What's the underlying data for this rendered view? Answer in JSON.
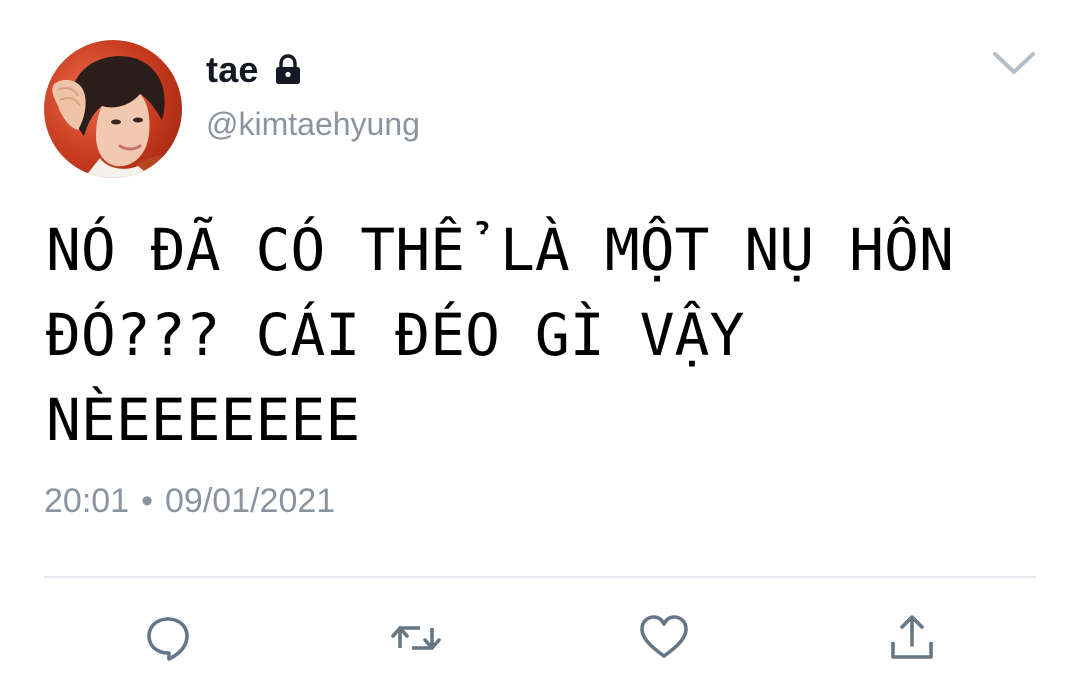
{
  "tweet": {
    "display_name": "tae",
    "handle": "@kimtaehyung",
    "text": "NÓ ĐÃ CÓ THỂ LÀ MỘT NỤ HÔN\nĐÓ??? CÁI ĐÉO GÌ VẬY\nNÈEEEEEEE",
    "time": "20:01",
    "separator": "•",
    "date": "09/01/2021"
  },
  "icons": {
    "verified_status": "lock-icon",
    "menu": "chevron-down-icon",
    "actions": [
      "reply-icon",
      "retweet-icon",
      "like-icon",
      "share-icon"
    ]
  },
  "colors": {
    "text": "#000000",
    "name": "#141823",
    "secondary": "#8a949e",
    "icon": "#657786",
    "divider": "#e3e6ea",
    "avatar_bg": "#c5381d"
  }
}
